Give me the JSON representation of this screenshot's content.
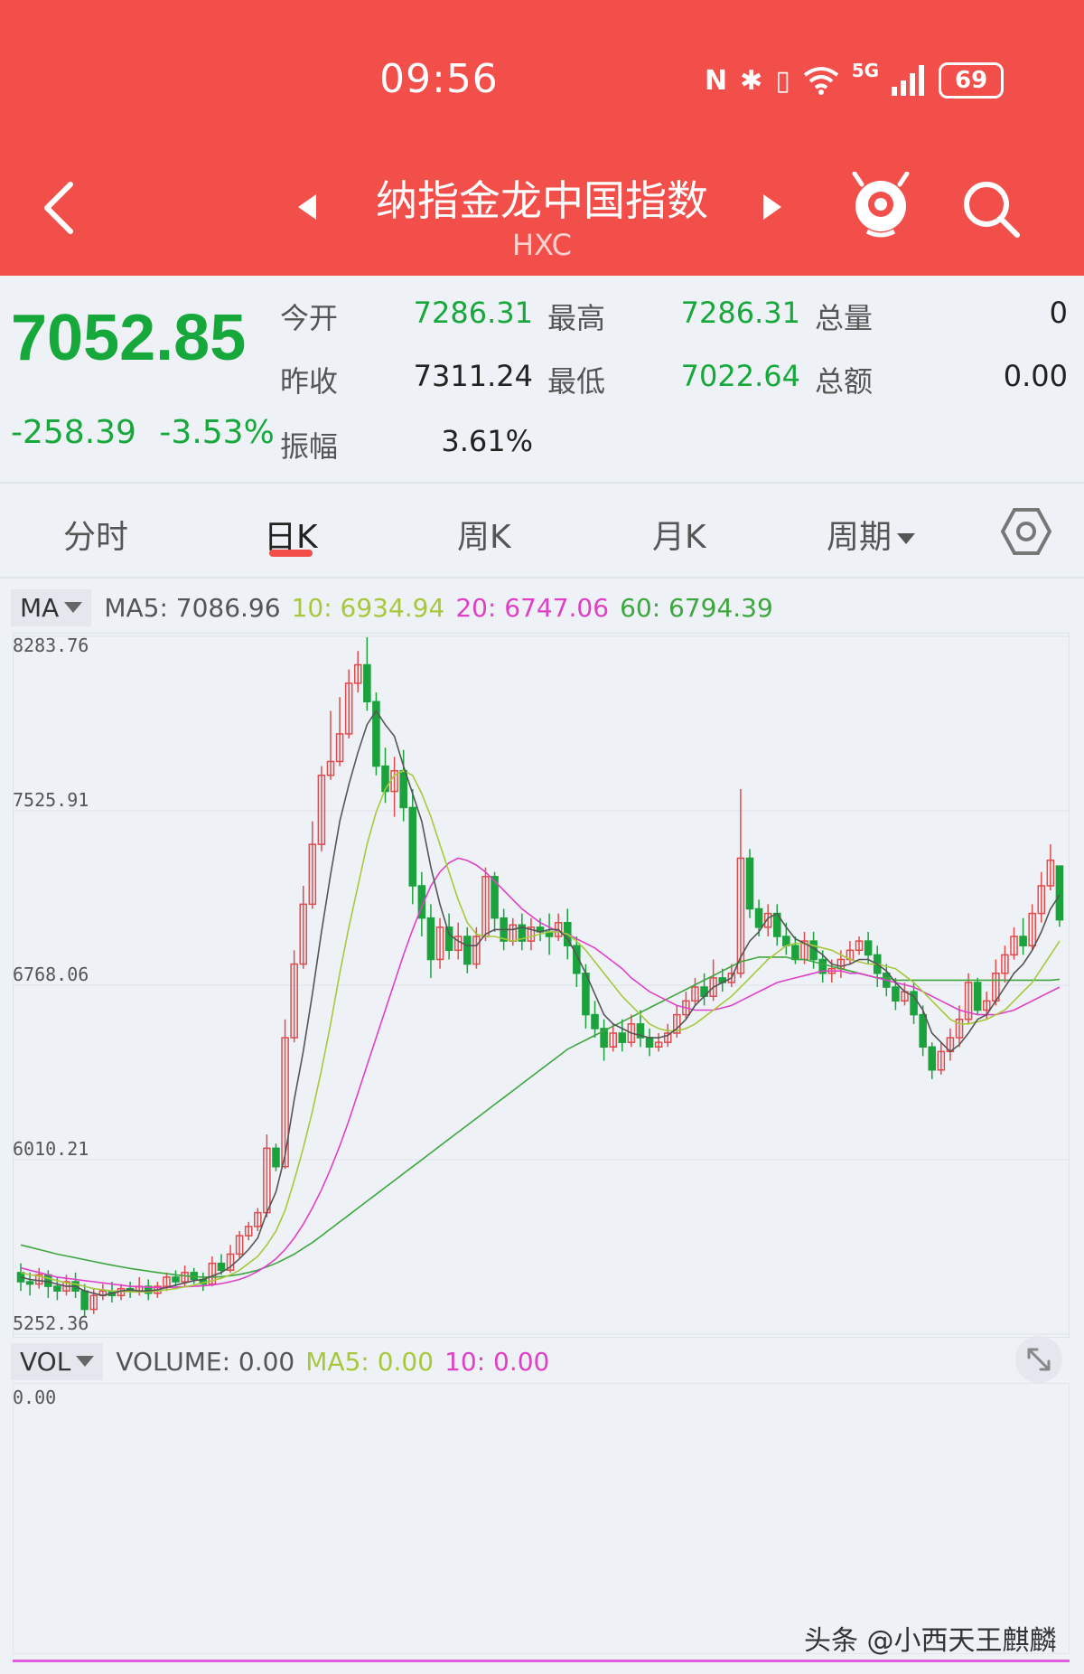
{
  "status_bar": {
    "time": "09:56",
    "network": "5G",
    "battery": "69"
  },
  "header": {
    "title": "纳指金龙中国指数",
    "subtitle": "HXC"
  },
  "quote": {
    "price": "7052.85",
    "change": "-258.39",
    "change_pct": "-3.53%",
    "open_label": "今开",
    "open": "7286.31",
    "high_label": "最高",
    "high": "7286.31",
    "volume_label": "总量",
    "volume": "0",
    "prev_close_label": "昨收",
    "prev_close": "7311.24",
    "low_label": "最低",
    "low": "7022.64",
    "amount_label": "总额",
    "amount": "0.00",
    "amplitude_label": "振幅",
    "amplitude": "3.61%"
  },
  "tabs": [
    "分时",
    "日K",
    "周K",
    "月K",
    "周期"
  ],
  "active_tab": "日K",
  "ma_legend": {
    "selector": "MA",
    "ma5": "MA5: 7086.96",
    "ma10": "10: 6934.94",
    "ma20": "20: 6747.06",
    "ma60": "60: 6794.39"
  },
  "colors": {
    "up": "#e24b4b",
    "down": "#1aa33c",
    "ma5": "#555555",
    "ma10": "#a8c83c",
    "ma20": "#e040c8",
    "ma60": "#3ea63e",
    "header": "#f24e4a"
  },
  "chart_data": {
    "type": "candlestick",
    "y_axis_labels": [
      "8283.76",
      "7525.91",
      "6768.06",
      "6010.21",
      "5252.36"
    ],
    "ylim": [
      5252.36,
      8283.76
    ],
    "candles": [
      [
        5520,
        5480,
        5560,
        5440
      ],
      [
        5480,
        5470,
        5520,
        5420
      ],
      [
        5470,
        5510,
        5540,
        5450
      ],
      [
        5510,
        5460,
        5530,
        5410
      ],
      [
        5460,
        5440,
        5500,
        5400
      ],
      [
        5440,
        5480,
        5510,
        5420
      ],
      [
        5480,
        5440,
        5520,
        5410
      ],
      [
        5440,
        5360,
        5470,
        5330
      ],
      [
        5360,
        5420,
        5450,
        5340
      ],
      [
        5420,
        5440,
        5470,
        5400
      ],
      [
        5440,
        5420,
        5480,
        5390
      ],
      [
        5420,
        5450,
        5470,
        5400
      ],
      [
        5450,
        5440,
        5480,
        5410
      ],
      [
        5440,
        5460,
        5500,
        5420
      ],
      [
        5460,
        5430,
        5490,
        5400
      ],
      [
        5430,
        5460,
        5480,
        5410
      ],
      [
        5460,
        5500,
        5520,
        5440
      ],
      [
        5500,
        5480,
        5530,
        5460
      ],
      [
        5480,
        5520,
        5550,
        5460
      ],
      [
        5520,
        5490,
        5540,
        5470
      ],
      [
        5490,
        5470,
        5520,
        5440
      ],
      [
        5470,
        5560,
        5590,
        5460
      ],
      [
        5560,
        5530,
        5600,
        5510
      ],
      [
        5530,
        5600,
        5640,
        5520
      ],
      [
        5600,
        5680,
        5700,
        5580
      ],
      [
        5680,
        5720,
        5740,
        5660
      ],
      [
        5720,
        5780,
        5800,
        5700
      ],
      [
        5780,
        6060,
        6120,
        5760
      ],
      [
        6060,
        5980,
        6080,
        5960
      ],
      [
        5980,
        6540,
        6620,
        5970
      ],
      [
        6540,
        6860,
        6920,
        6520
      ],
      [
        6860,
        7120,
        7200,
        6840
      ],
      [
        7120,
        7380,
        7480,
        7100
      ],
      [
        7380,
        7680,
        7720,
        7350
      ],
      [
        7680,
        7740,
        7960,
        7660
      ],
      [
        7740,
        7860,
        8020,
        7720
      ],
      [
        7860,
        8080,
        8140,
        7840
      ],
      [
        8080,
        8160,
        8220,
        8040
      ],
      [
        8160,
        8000,
        8280,
        7960
      ],
      [
        8000,
        7720,
        8040,
        7680
      ],
      [
        7720,
        7610,
        7800,
        7560
      ],
      [
        7610,
        7700,
        7760,
        7500
      ],
      [
        7700,
        7540,
        7790,
        7480
      ],
      [
        7540,
        7200,
        7620,
        7120
      ],
      [
        7200,
        7060,
        7260,
        6980
      ],
      [
        7060,
        6880,
        7120,
        6800
      ],
      [
        6880,
        7020,
        7060,
        6840
      ],
      [
        7020,
        6920,
        7080,
        6880
      ],
      [
        6920,
        6980,
        7040,
        6880
      ],
      [
        6980,
        6860,
        7020,
        6820
      ],
      [
        6860,
        6980,
        7020,
        6840
      ],
      [
        6980,
        7240,
        7280,
        6960
      ],
      [
        7240,
        7060,
        7260,
        7000
      ],
      [
        7060,
        6960,
        7100,
        6920
      ],
      [
        6960,
        7030,
        7060,
        6940
      ],
      [
        7030,
        6960,
        7080,
        6920
      ],
      [
        6960,
        7020,
        7060,
        6920
      ],
      [
        7020,
        7000,
        7060,
        6960
      ],
      [
        7000,
        6980,
        7080,
        6900
      ],
      [
        6980,
        7040,
        7080,
        6960
      ],
      [
        7040,
        6940,
        7100,
        6880
      ],
      [
        6940,
        6820,
        6980,
        6760
      ],
      [
        6820,
        6640,
        6860,
        6580
      ],
      [
        6640,
        6580,
        6700,
        6540
      ],
      [
        6580,
        6500,
        6620,
        6440
      ],
      [
        6500,
        6560,
        6600,
        6480
      ],
      [
        6560,
        6520,
        6620,
        6480
      ],
      [
        6520,
        6600,
        6640,
        6500
      ],
      [
        6600,
        6540,
        6660,
        6500
      ],
      [
        6540,
        6500,
        6580,
        6460
      ],
      [
        6500,
        6520,
        6560,
        6480
      ],
      [
        6520,
        6560,
        6600,
        6500
      ],
      [
        6560,
        6640,
        6680,
        6540
      ],
      [
        6640,
        6700,
        6740,
        6620
      ],
      [
        6700,
        6760,
        6800,
        6680
      ],
      [
        6760,
        6720,
        6820,
        6680
      ],
      [
        6720,
        6800,
        6880,
        6700
      ],
      [
        6800,
        6780,
        6840,
        6740
      ],
      [
        6780,
        6820,
        6860,
        6760
      ],
      [
        6820,
        7320,
        7620,
        6800
      ],
      [
        7320,
        7100,
        7360,
        7060
      ],
      [
        7100,
        7020,
        7140,
        6980
      ],
      [
        7020,
        7080,
        7120,
        6980
      ],
      [
        7080,
        6980,
        7120,
        6940
      ],
      [
        6980,
        6940,
        7040,
        6900
      ],
      [
        6940,
        6880,
        6980,
        6860
      ],
      [
        6880,
        6960,
        7000,
        6860
      ],
      [
        6960,
        6880,
        7000,
        6840
      ],
      [
        6880,
        6820,
        6920,
        6780
      ],
      [
        6820,
        6840,
        6880,
        6780
      ],
      [
        6840,
        6880,
        6920,
        6800
      ],
      [
        6880,
        6920,
        6960,
        6860
      ],
      [
        6920,
        6960,
        6980,
        6900
      ],
      [
        6960,
        6900,
        7000,
        6860
      ],
      [
        6900,
        6820,
        6940,
        6760
      ],
      [
        6820,
        6760,
        6860,
        6720
      ],
      [
        6760,
        6700,
        6800,
        6660
      ],
      [
        6700,
        6740,
        6780,
        6680
      ],
      [
        6740,
        6640,
        6780,
        6600
      ],
      [
        6640,
        6500,
        6680,
        6460
      ],
      [
        6500,
        6400,
        6520,
        6360
      ],
      [
        6400,
        6480,
        6520,
        6380
      ],
      [
        6480,
        6540,
        6580,
        6440
      ],
      [
        6540,
        6620,
        6680,
        6500
      ],
      [
        6620,
        6780,
        6820,
        6600
      ],
      [
        6780,
        6660,
        6800,
        6640
      ],
      [
        6660,
        6700,
        6740,
        6620
      ],
      [
        6700,
        6820,
        6880,
        6680
      ],
      [
        6820,
        6900,
        6940,
        6780
      ],
      [
        6900,
        6980,
        7020,
        6880
      ],
      [
        6980,
        6940,
        7060,
        6900
      ],
      [
        6940,
        7080,
        7120,
        6920
      ],
      [
        7080,
        7200,
        7260,
        7040
      ],
      [
        7200,
        7311,
        7380,
        7180
      ],
      [
        7286,
        7052,
        7286,
        7022
      ]
    ],
    "ma5": [
      5500,
      5490,
      5485,
      5480,
      5470,
      5460,
      5460,
      5440,
      5430,
      5420,
      5430,
      5440,
      5445,
      5440,
      5440,
      5445,
      5455,
      5465,
      5475,
      5485,
      5490,
      5505,
      5520,
      5545,
      5580,
      5620,
      5670,
      5780,
      5870,
      6030,
      6270,
      6480,
      6730,
      7000,
      7250,
      7480,
      7640,
      7780,
      7900,
      7960,
      7900,
      7850,
      7720,
      7600,
      7480,
      7280,
      7120,
      6990,
      6960,
      6940,
      6940,
      6990,
      7010,
      7010,
      7010,
      7020,
      7010,
      7000,
      7010,
      7010,
      6970,
      6900,
      6820,
      6730,
      6640,
      6600,
      6580,
      6560,
      6550,
      6540,
      6540,
      6550,
      6580,
      6620,
      6680,
      6720,
      6760,
      6780,
      6800,
      6890,
      6960,
      7000,
      7060,
      7080,
      7020,
      6970,
      6950,
      6930,
      6900,
      6860,
      6850,
      6860,
      6880,
      6880,
      6860,
      6830,
      6780,
      6740,
      6720,
      6660,
      6560,
      6520,
      6480,
      6510,
      6560,
      6620,
      6640,
      6700,
      6760,
      6820,
      6860,
      6920,
      7000,
      7100,
      7160
    ],
    "ma10": [
      5520,
      5510,
      5505,
      5495,
      5485,
      5475,
      5470,
      5460,
      5450,
      5445,
      5440,
      5438,
      5436,
      5435,
      5436,
      5440,
      5445,
      5450,
      5458,
      5465,
      5475,
      5485,
      5495,
      5510,
      5530,
      5560,
      5590,
      5640,
      5700,
      5790,
      5920,
      6060,
      6220,
      6400,
      6600,
      6820,
      7020,
      7200,
      7380,
      7520,
      7620,
      7680,
      7700,
      7680,
      7600,
      7500,
      7380,
      7260,
      7140,
      7040,
      6990,
      6980,
      6980,
      6970,
      6960,
      6970,
      6980,
      6990,
      7000,
      7000,
      6990,
      6960,
      6920,
      6870,
      6820,
      6770,
      6720,
      6680,
      6640,
      6600,
      6580,
      6570,
      6570,
      6580,
      6600,
      6630,
      6660,
      6690,
      6720,
      6760,
      6800,
      6840,
      6880,
      6910,
      6940,
      6950,
      6950,
      6940,
      6930,
      6920,
      6900,
      6880,
      6870,
      6860,
      6860,
      6850,
      6840,
      6810,
      6780,
      6740,
      6700,
      6660,
      6620,
      6600,
      6600,
      6610,
      6620,
      6640,
      6660,
      6700,
      6740,
      6780,
      6840,
      6900,
      6960
    ],
    "ma20": [
      5540,
      5530,
      5520,
      5510,
      5500,
      5495,
      5490,
      5485,
      5480,
      5475,
      5470,
      5465,
      5460,
      5458,
      5456,
      5455,
      5455,
      5456,
      5458,
      5460,
      5462,
      5466,
      5472,
      5480,
      5490,
      5505,
      5525,
      5550,
      5580,
      5620,
      5670,
      5730,
      5800,
      5880,
      5970,
      6070,
      6180,
      6300,
      6420,
      6540,
      6660,
      6780,
      6900,
      7010,
      7110,
      7200,
      7260,
      7300,
      7320,
      7310,
      7290,
      7260,
      7220,
      7180,
      7140,
      7100,
      7070,
      7040,
      7020,
      7000,
      6990,
      6970,
      6950,
      6930,
      6900,
      6870,
      6840,
      6800,
      6770,
      6740,
      6720,
      6700,
      6680,
      6670,
      6660,
      6660,
      6660,
      6670,
      6680,
      6700,
      6720,
      6740,
      6760,
      6780,
      6790,
      6800,
      6810,
      6820,
      6830,
      6830,
      6830,
      6820,
      6820,
      6810,
      6800,
      6790,
      6780,
      6770,
      6760,
      6740,
      6720,
      6700,
      6680,
      6660,
      6650,
      6640,
      6640,
      6640,
      6650,
      6660,
      6680,
      6700,
      6720,
      6740,
      6760
    ],
    "ma60": [
      5640,
      5630,
      5620,
      5610,
      5600,
      5592,
      5584,
      5576,
      5568,
      5560,
      5552,
      5545,
      5538,
      5532,
      5526,
      5520,
      5515,
      5510,
      5506,
      5502,
      5500,
      5500,
      5502,
      5506,
      5512,
      5520,
      5530,
      5545,
      5560,
      5580,
      5600,
      5625,
      5650,
      5680,
      5710,
      5740,
      5770,
      5800,
      5830,
      5860,
      5890,
      5920,
      5950,
      5980,
      6010,
      6040,
      6070,
      6100,
      6130,
      6160,
      6190,
      6220,
      6250,
      6280,
      6310,
      6340,
      6370,
      6400,
      6430,
      6460,
      6490,
      6510,
      6530,
      6550,
      6570,
      6590,
      6610,
      6630,
      6650,
      6670,
      6690,
      6710,
      6730,
      6750,
      6770,
      6790,
      6810,
      6830,
      6850,
      6870,
      6880,
      6890,
      6890,
      6890,
      6890,
      6880,
      6880,
      6870,
      6860,
      6850,
      6840,
      6830,
      6820,
      6810,
      6800,
      6800,
      6790,
      6790,
      6790,
      6790,
      6790,
      6790,
      6790,
      6790,
      6790,
      6790,
      6790,
      6790,
      6790,
      6790,
      6790,
      6790,
      6790,
      6790,
      6794
    ]
  },
  "volume": {
    "selector": "VOL",
    "volume": "VOLUME: 0.00",
    "ma5": "MA5: 0.00",
    "ma10": "10: 0.00",
    "axis_label": "0.00"
  },
  "watermark": "头条 @小西天王麒麟"
}
